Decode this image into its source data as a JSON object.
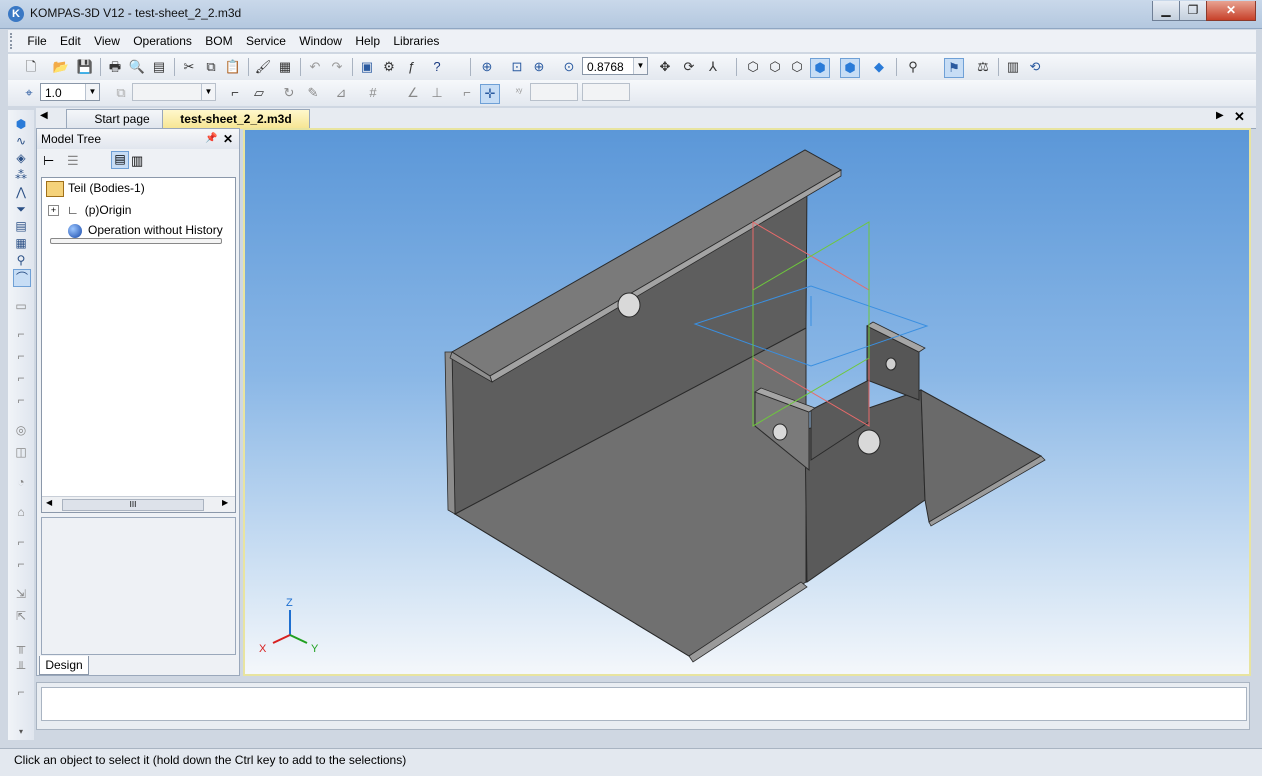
{
  "window": {
    "title": "KOMPAS-3D V12 - test-sheet_2_2.m3d",
    "app_icon": "K"
  },
  "window_buttons": {
    "minimize": "▁",
    "restore": "❐",
    "close": "✕"
  },
  "menu": [
    "File",
    "Edit",
    "View",
    "Operations",
    "BOM",
    "Service",
    "Window",
    "Help",
    "Libraries"
  ],
  "toolbar1": {
    "zoom_value": "0.8768"
  },
  "toolbar2": {
    "step_value": "1.0"
  },
  "tabs": {
    "start": "Start page",
    "document": "test-sheet_2_2.m3d"
  },
  "tree": {
    "title": "Model Tree",
    "items": [
      "Teil (Bodies-1)",
      "(p)Origin",
      "Operation without History"
    ],
    "pane_tab": "Design",
    "scroll_grip": "III"
  },
  "triad": {
    "x": "X",
    "y": "Y",
    "z": "Z"
  },
  "status": "Click an object to select it (hold down the Ctrl key to add to the selections)",
  "colors": {
    "part": "#6f6f6f",
    "viewport_top": "#5b97d8",
    "plane_xy": "#3a8fe0",
    "plane_yz": "#e86a6a",
    "plane_zx": "#6ec83c",
    "active_border": "#e8e4a0"
  }
}
